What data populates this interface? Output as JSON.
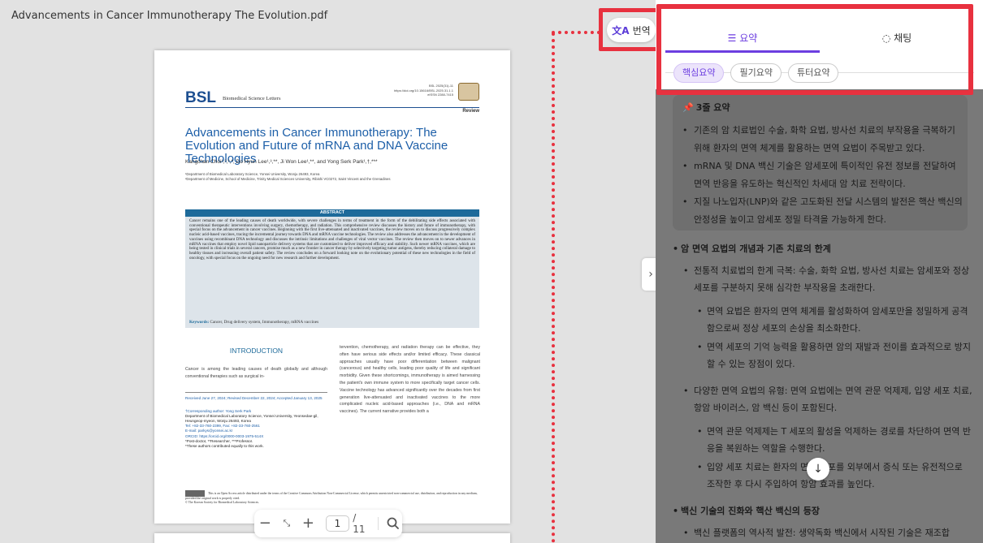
{
  "viewer": {
    "title": "Advancements in Cancer Immunotherapy The Evolution.pdf"
  },
  "paper": {
    "logo": "BSL",
    "logo_sub": "Biomedical Science Letters",
    "meta": [
      "BSL 2025(31)-11",
      "https://doi.org/10.15616/BSL.2025.31.1.1",
      "eISSN 2288-7415"
    ],
    "section_type": "Review",
    "title": "Advancements in Cancer Immunotherapy: The Evolution and Future of mRNA and DNA Vaccine Technologies",
    "authors": "Kangchan Choi¹,²,³,*, Do Hyun Lee¹,³,**, Ji Won Lee¹,**, and Yong Serk Park¹,†,***",
    "affiliations": [
      "¹Department of Biomedical Laboratory Science, Yonsei University, Wonju 26493, Korea",
      "²Department of Medicine, School of Medicine, Trinity Medical Sciences University, Ribishi VC0272, Saint Vincent and the Grenadines"
    ],
    "abstract_head": "ABSTRACT",
    "abstract_text": "Cancer remains one of the leading causes of death worldwide, with severe challenges in terms of treatment in the form of the debilitating side effects associated with conventional therapeutic interventions involving surgery, chemotherapy, and radiation. This comprehensive review discusses the history and future of immunotherapy, with special focus on the advancement in cancer vaccines. Beginning with the first live-attenuated and inactivated vaccines, the review moves on to discuss progressively complex nucleic acid-based vaccines, tracing the incremental journey towards DNA and mRNA vaccine technologies. The review also addresses the advancement in the development of vaccines using recombinant DNA technology and discusses the intrinsic limitations and challenges of viral vector vaccines. The review then moves on to newer advances in mRNA vaccines that employ novel lipid nanoparticle delivery systems that are customized to deliver improved efficacy and stability. Such newer mRNA vaccines, which are being tested in clinical trials in several cancers, promise much as a new frontier in cancer therapy by selectively targeting tumor antigens, thereby reducing collateral damage to healthy tissues and increasing overall patient safety. The review concludes on a forward looking note on the evolutionary potential of these new technologies in the field of oncology, with special focus on the ongoing need for new research and further development.",
    "keywords_label": "Keywords:",
    "keywords": "Cancer, Drug delivery system, Immunotherapy, mRNA vaccines",
    "intro_head": "INTRODUCTION",
    "intro_text": "Cancer is among the leading causes of death globally and although conventional therapies such as surgical in-",
    "received": "Received June 27, 2024; Revised December 22, 2024; Accepted January 13, 2025",
    "corresp": [
      "†Corresponding author: Yong Serk Park",
      "Department of Biomedical Laboratory Science, Yonsei University, Yeonsedae-gil, Heungeop-myeon, Wonju 26493, Korea",
      "Tel: +82-33-760-2399, Fax: +82-33-760-2561",
      "E-mail: parkys@yonsei.ac.kr",
      "ORCID: https://orcid.org/0000-0003-1975-514X",
      "*Post-doctor, **Researcher, ***Professor.",
      "*These authors contributed equally to this work."
    ],
    "right_col": "tervention, chemotherapy, and radiation therapy can be effective, they often have serious side effects and/or limited efficacy. These classical approaches usually have poor differentiation between malignant (cancerous) and healthy cells, leading poor quality of life and significant morbidity. Given these shortcomings, immunotherapy is aimed harnessing the patient's own immune system to more specifically target cancer cells. Vaccine technology has advanced significantly over the decades from first generation live-attenuated and inactivated vaccines to the more complicated nucleic acid-based approaches (i.e., DNA and mRNA vaccines). The current narrative provides both a",
    "licence": "This is an Open Access article distributed under the terms of the Creative Commons Attribution Non-Commercial License, which permits unrestricted non-commercial use, distribution, and reproduction in any medium, provided the original work is properly cited.",
    "copyright": "© The Korean Society for Biomedical Laboratory Sciences."
  },
  "toolbar": {
    "zoom_out": "−",
    "fit": "⤡",
    "zoom_in": "+",
    "page_current": "1",
    "page_total": "/ 11"
  },
  "translate": {
    "label": "번역",
    "icon": "translate-icon"
  },
  "panel": {
    "tabs": [
      {
        "label": "요약",
        "icon": "summary-icon"
      },
      {
        "label": "채팅",
        "icon": "chat-icon"
      }
    ],
    "chips": [
      "핵심요약",
      "필기요약",
      "튜터요약"
    ],
    "summary_title": "3줄 요약",
    "summary_items": [
      "기존의 암 치료법인 수술, 화학 요법, 방사선 치료의 부작용을 극복하기 위해 환자의 면역 체계를 활용하는 면역 요법이 주목받고 있다.",
      "mRNA 및 DNA 백신 기술은 암세포에 특이적인 유전 정보를 전달하여 면역 반응을 유도하는 혁신적인 차세대 암 치료 전략이다.",
      "지질 나노입자(LNP)와 같은 고도화된 전달 시스템의 발전은 핵산 백신의 안정성을 높이고 암세포 정밀 타격을 가능하게 한다."
    ],
    "sections": [
      {
        "title": "암 면역 요법의 개념과 기존 치료의 한계",
        "items": [
          {
            "text": "전통적 치료법의 한계 극복: 수술, 화학 요법, 방사선 치료는 암세포와 정상 세포를 구분하지 못해 심각한 부작용을 초래한다.",
            "sub": [
              "면역 요법은 환자의 면역 체계를 활성화하여 암세포만을 정밀하게 공격함으로써 정상 세포의 손상을 최소화한다.",
              "면역 세포의 기억 능력을 활용하면 암의 재발과 전이를 효과적으로 방지할 수 있는 장점이 있다."
            ]
          },
          {
            "text": "다양한 면역 요법의 유형: 면역 요법에는 면역 관문 억제제, 입양 세포 치료, 항암 바이러스, 암 백신 등이 포함된다.",
            "sub": [
              "면역 관문 억제제는 T 세포의 활성을 억제하는 경로를 차단하여 면역 반응을 복원하는 역할을 수행한다.",
              "입양 세포 치료는 환자의 면역 세포를 외부에서 증식 또는 유전적으로 조작한 후 다시 주입하여 항암 효과를 높인다."
            ]
          }
        ]
      },
      {
        "title": "백신 기술의 진화와 핵산 백신의 등장",
        "items": [
          {
            "text": "백신 플랫폼의 역사적 발전: 생약독화 백신에서 시작된 기술은 재조합",
            "sub": []
          }
        ]
      }
    ]
  },
  "colors": {
    "accent": "#6c3ee0",
    "highlight_border": "#e8313f"
  }
}
